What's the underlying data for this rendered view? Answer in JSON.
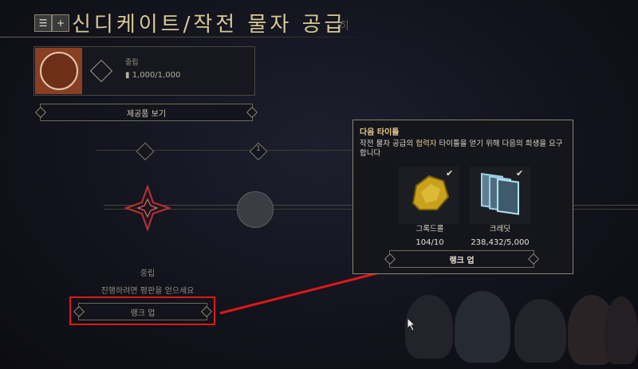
{
  "header": {
    "title": "신디케이트/작전 물자 공급",
    "trailing_fragment": "히"
  },
  "faction_card": {
    "label": "중립",
    "value": "1,000/1,000"
  },
  "view_rewards_button": "제공품 보기",
  "track": {
    "marker_numeral": "1"
  },
  "left_panel": {
    "standing": "중립",
    "hint": "진행하려면 평판을 얻으세요",
    "rank_up_button": "랭크 업"
  },
  "popup": {
    "title": "다음 타이틀",
    "desc_pre": "작전 물자 공급의 ",
    "desc_highlight": "협력자",
    "desc_post": " 타이틀을 얻기 위해 다음의 희생을 요구합니다",
    "items": [
      {
        "name": "그록드롤",
        "count": "104/10",
        "icon": "gold-ore-icon"
      },
      {
        "name": "크레딧",
        "count": "238,432/5,000",
        "icon": "credits-icon"
      }
    ],
    "check_glyph": "✔",
    "rank_up_button": "랭크 업"
  },
  "colors": {
    "accent_gold": "#e3c88a",
    "annotation_red": "#e01818",
    "emblem_orange": "#8a3f22"
  }
}
